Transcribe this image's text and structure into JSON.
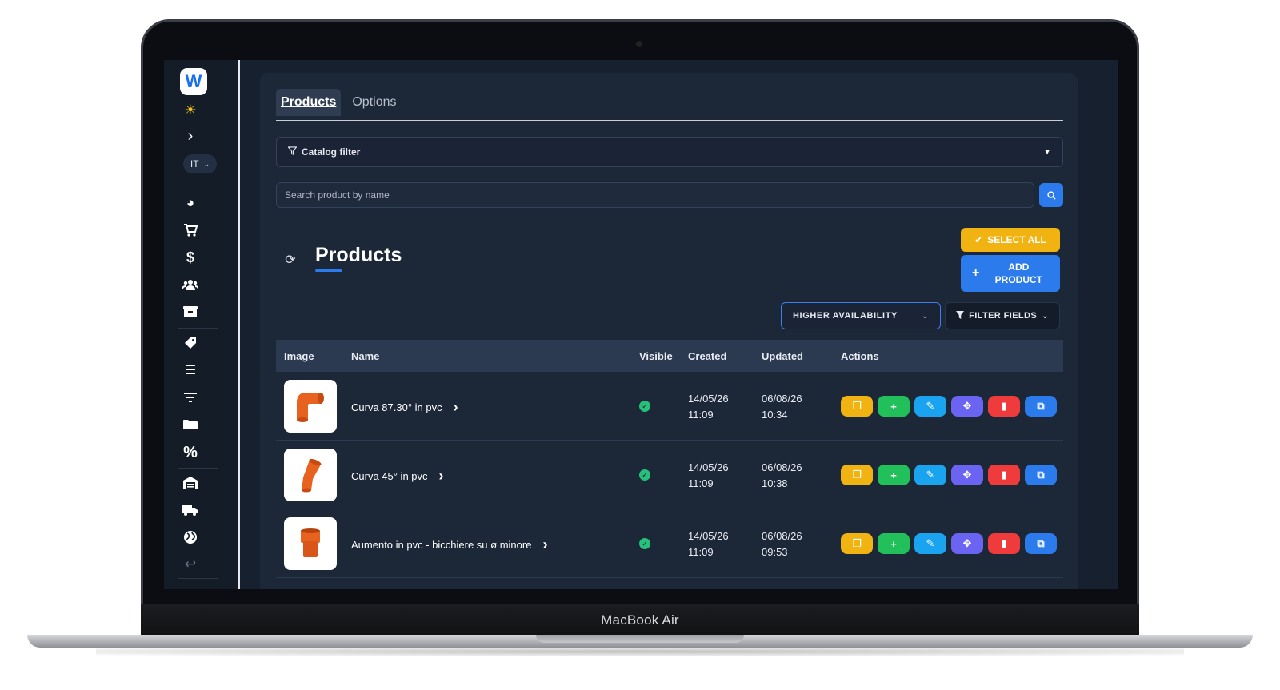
{
  "device": {
    "label": "MacBook Air"
  },
  "sidebar": {
    "logo": "W",
    "language": "IT",
    "icons": [
      "sun-icon",
      "chevron-right-icon",
      "pie-chart-icon",
      "cart-icon",
      "dollar-icon",
      "users-icon",
      "box-icon",
      "tag-icon",
      "list-icon",
      "filter-icon",
      "folder-icon",
      "percent-icon",
      "warehouse-icon",
      "truck-icon",
      "globe-icon",
      "return-icon"
    ]
  },
  "tabs": [
    {
      "label": "Products",
      "active": true
    },
    {
      "label": "Options",
      "active": false
    }
  ],
  "catalog_filter": {
    "label": "Catalog filter"
  },
  "search": {
    "placeholder": "Search product by name"
  },
  "header": {
    "title": "Products",
    "select_all": "SELECT ALL",
    "add_product_line1": "ADD",
    "add_product_line2": "PRODUCT"
  },
  "sort": {
    "selected": "HIGHER AVAILABILITY"
  },
  "filter_fields": {
    "label": "FILTER FIELDS"
  },
  "table": {
    "columns": [
      "Image",
      "Name",
      "Visible",
      "Created",
      "Updated",
      "Actions"
    ],
    "rows": [
      {
        "name": "Curva 87.30° in pvc",
        "visible": true,
        "created_date": "14/05/26",
        "created_time": "11:09",
        "updated_date": "06/08/26",
        "updated_time": "10:34"
      },
      {
        "name": "Curva 45° in pvc",
        "visible": true,
        "created_date": "14/05/26",
        "created_time": "11:09",
        "updated_date": "06/08/26",
        "updated_time": "10:38"
      },
      {
        "name": "Aumento in pvc - bicchiere su ø minore",
        "visible": true,
        "created_date": "14/05/26",
        "created_time": "11:09",
        "updated_date": "06/08/26",
        "updated_time": "09:53"
      }
    ]
  },
  "colors": {
    "accent": "#2b7bec",
    "warning": "#f0b311",
    "success": "#22c05a",
    "danger": "#ef3b3b",
    "info": "#1aa3ee",
    "violet": "#6b63f2",
    "background": "#16202e",
    "product": "#e8621f"
  }
}
